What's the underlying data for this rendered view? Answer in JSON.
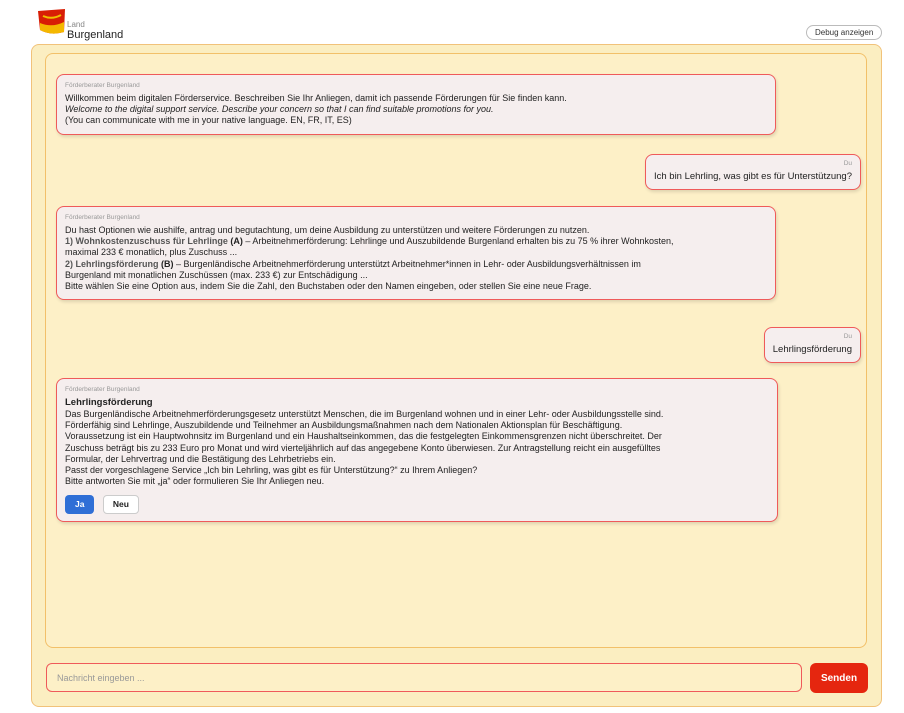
{
  "header": {
    "logo_land": "Land",
    "logo_name": "Burgenland",
    "debug_label": "Debug anzeigen"
  },
  "colors": {
    "brand_red": "#e5260f",
    "frame_yellow": "#fbeec1",
    "bubble_border": "#ef5a5a",
    "primary_button": "#2f6fd6"
  },
  "messages": [
    {
      "sender": "Förderberater Burgenland",
      "lines": [
        "Willkommen beim digitalen Förderservice. Beschreiben Sie Ihr Anliegen, damit ich passende Förderungen für Sie finden kann.",
        "Welcome to the digital support service. Describe your concern so that I can find suitable promotions for you.",
        "(You can communicate with me in your native language. EN, FR, IT, ES)"
      ]
    },
    {
      "sender": "Du",
      "text": "Ich bin Lehrling, was gibt es für Unterstützung?"
    },
    {
      "sender": "Förderberater Burgenland",
      "intro": "Du hast Optionen wie aushilfe, antrag und begutachtung, um deine Ausbildung zu unterstützen und weitere Förderungen zu nutzen.",
      "options": [
        {
          "num": "1)",
          "name": "Wohnkostenzuschuss für Lehrlinge",
          "letter": "(A)",
          "desc1": " – Arbeitnehmerförderung: Lehrlinge und Auszubildende Burgenland erhalten bis zu 75 % ihrer Wohnkosten,",
          "desc2": "maximal 233 € monatlich, plus Zuschuss ..."
        },
        {
          "num": "2)",
          "name": "Lehrlingsförderung",
          "letter": "(B)",
          "desc1": " – Burgenländische Arbeitnehmerförderung unterstützt Arbeitnehmer*innen in Lehr- oder Ausbildungsverhältnissen im",
          "desc2": "Burgenland mit monatlichen Zuschüssen (max. 233 €) zur Entschädigung ..."
        }
      ],
      "outro": "Bitte wählen Sie eine Option aus, indem Sie die Zahl, den Buchstaben oder den Namen eingeben, oder stellen Sie eine neue Frage."
    },
    {
      "sender": "Du",
      "text": "Lehrlingsförderung"
    },
    {
      "sender": "Förderberater Burgenland",
      "title": "Lehrlingsförderung",
      "lines": [
        "Das Burgenländische Arbeitnehmerförderungsgesetz unterstützt Menschen, die im Burgenland wohnen und in einer Lehr- oder Ausbildungsstelle sind.",
        "Förderfähig sind Lehrlinge, Auszubildende und Teilnehmer an Ausbildungsmaßnahmen nach dem Nationalen Aktionsplan für Beschäftigung.",
        "Voraussetzung ist ein Hauptwohnsitz im Burgenland und ein Haushaltseinkommen, das die festgelegten Einkommensgrenzen nicht überschreitet. Der",
        "Zuschuss beträgt bis zu 233 Euro pro Monat und wird vierteljährlich auf das angegebene Konto überwiesen. Zur Antragstellung reicht ein ausgefülltes",
        "Formular, der Lehrvertrag und die Bestätigung des Lehrbetriebs ein.",
        "Passt der vorgeschlagene Service „Ich bin Lehrling, was gibt es für Unterstützung?“ zu Ihrem Anliegen?",
        "Bitte antworten Sie mit „ja“ oder formulieren Sie Ihr Anliegen neu."
      ],
      "yes_label": "Ja",
      "no_label": "Neu"
    }
  ],
  "composer": {
    "placeholder": "Nachricht eingeben ...",
    "send_label": "Senden"
  }
}
